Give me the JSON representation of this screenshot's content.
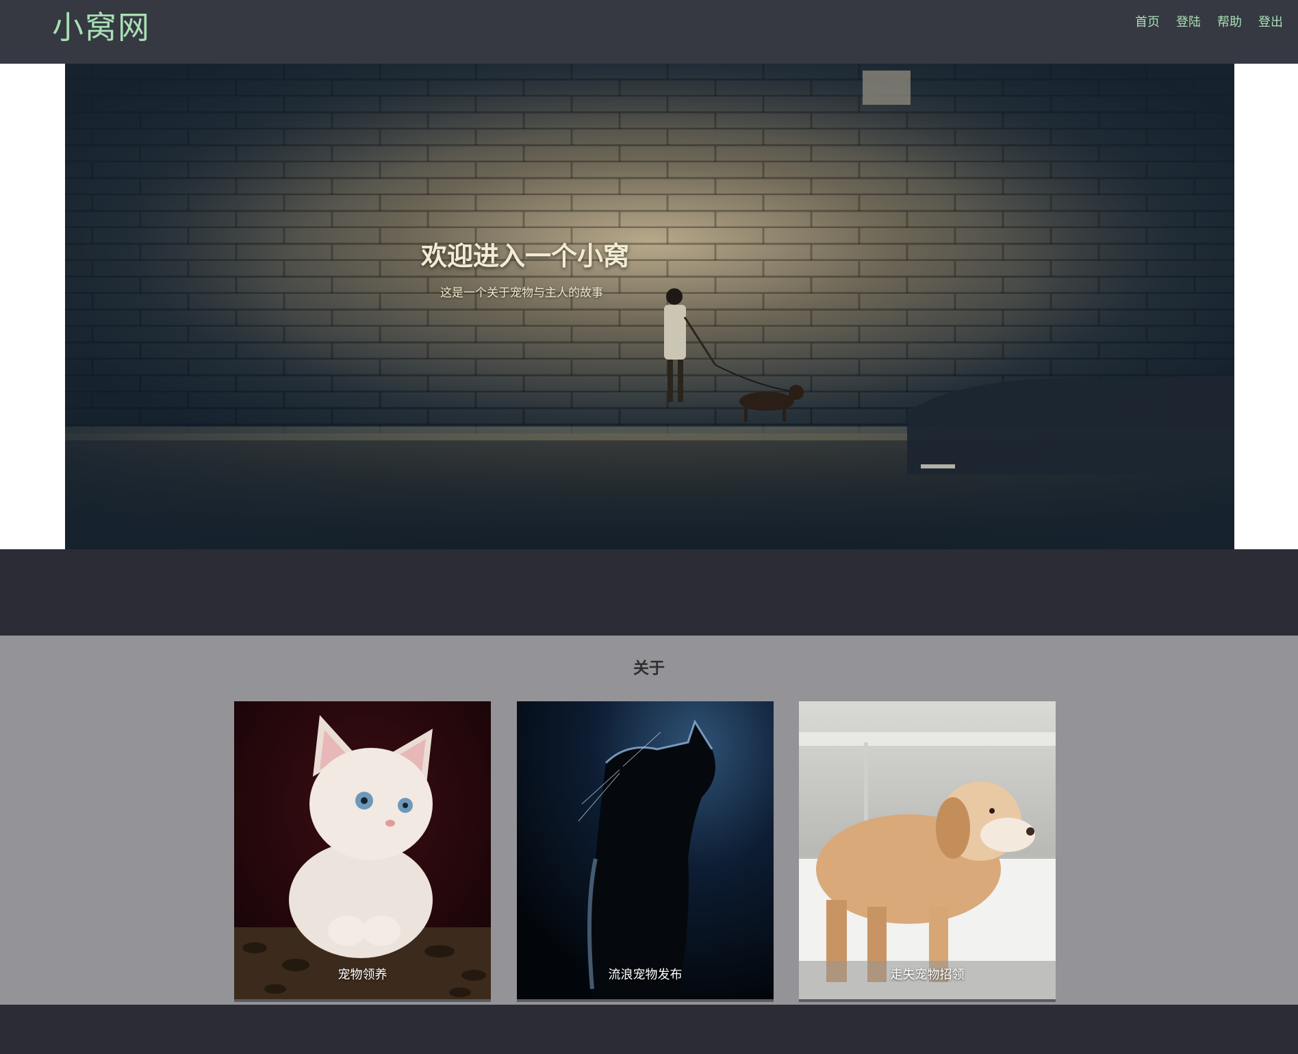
{
  "site": {
    "logo": "小窝网"
  },
  "nav": {
    "items": [
      {
        "label": "首页"
      },
      {
        "label": "登陆"
      },
      {
        "label": "帮助"
      },
      {
        "label": "登出"
      }
    ]
  },
  "hero": {
    "title": "欢迎进入一个小窝",
    "subtitle": "这是一个关于宠物与主人的故事"
  },
  "about": {
    "title": "关于",
    "cards": [
      {
        "caption": "宠物领养",
        "image": "white-kitten-photo"
      },
      {
        "caption": "流浪宠物发布",
        "image": "cat-silhouette-photo"
      },
      {
        "caption": "走失宠物招领",
        "image": "golden-retriever-snow-photo"
      }
    ]
  },
  "colors": {
    "header_bg": "#363842",
    "accent_green": "#a7e0b4",
    "about_bg": "#949398",
    "footer_bg": "#2b2c35"
  }
}
